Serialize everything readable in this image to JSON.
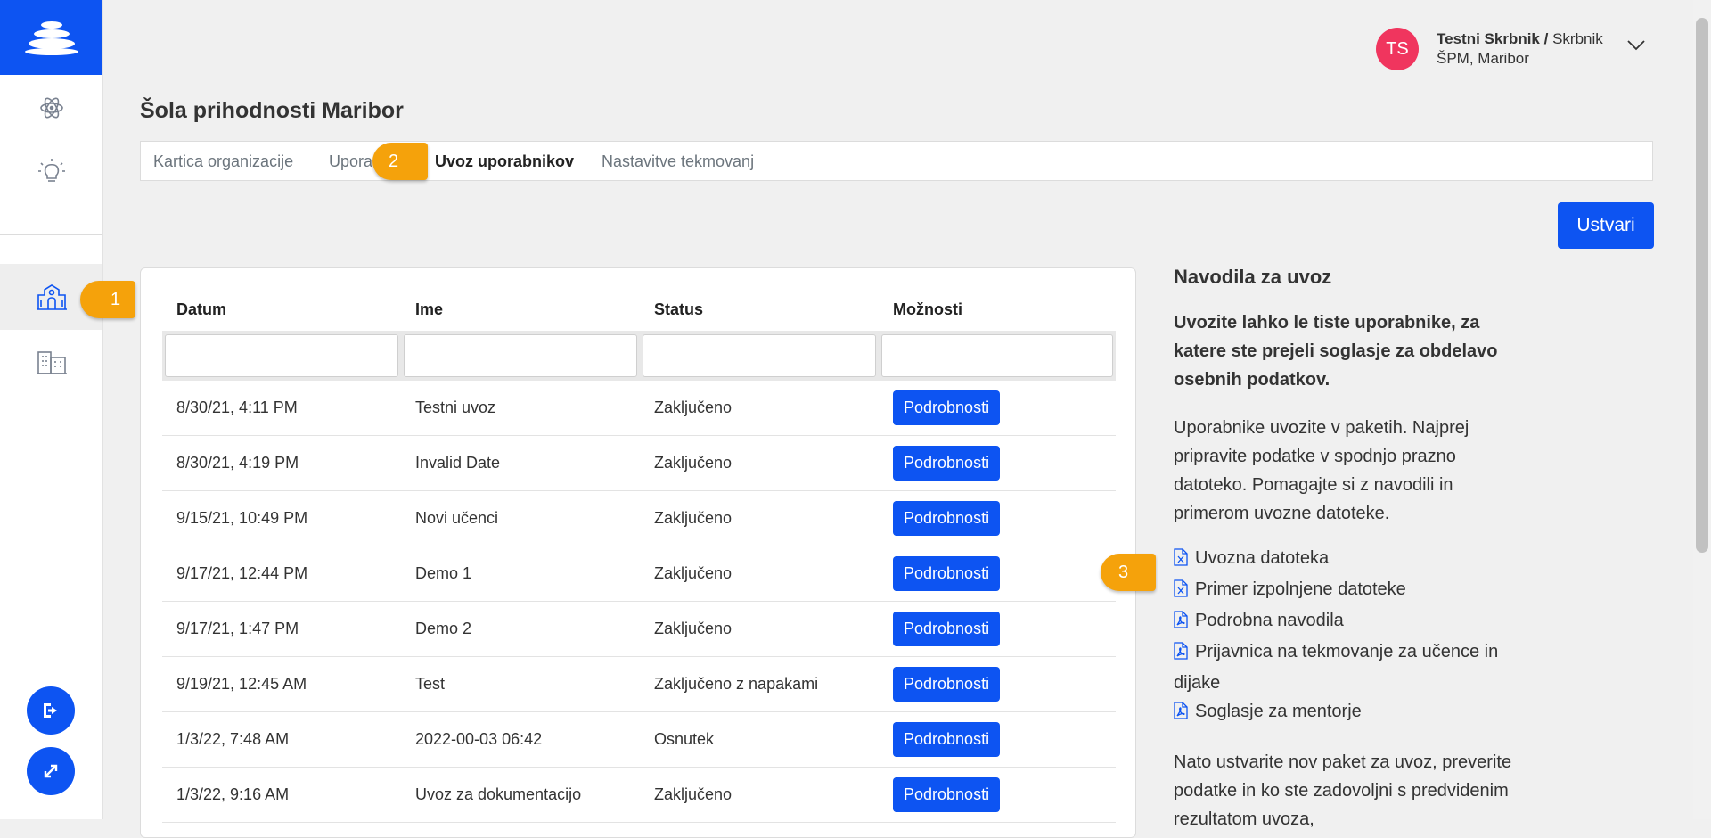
{
  "user": {
    "initials": "TS",
    "name": "Testni Skrbnik /",
    "role": "Skrbnik",
    "org": "ŠPM, Maribor"
  },
  "page": {
    "title": "Šola prihodnosti Maribor"
  },
  "tabs": [
    {
      "label": "Kartica organizacije"
    },
    {
      "label": "Upora"
    },
    {
      "label": "Uvoz uporabnikov"
    },
    {
      "label": "Nastavitve tekmovanj"
    }
  ],
  "actions": {
    "create": "Ustvari"
  },
  "table": {
    "headers": [
      "Datum",
      "Ime",
      "Status",
      "Možnosti"
    ],
    "button_label": "Podrobnosti",
    "rows": [
      {
        "date": "8/30/21, 4:11 PM",
        "name": "Testni uvoz",
        "status": "Zaključeno"
      },
      {
        "date": "8/30/21, 4:19 PM",
        "name": "Invalid Date",
        "status": "Zaključeno"
      },
      {
        "date": "9/15/21, 10:49 PM",
        "name": "Novi učenci",
        "status": "Zaključeno"
      },
      {
        "date": "9/17/21, 12:44 PM",
        "name": "Demo 1",
        "status": "Zaključeno"
      },
      {
        "date": "9/17/21, 1:47 PM",
        "name": "Demo 2",
        "status": "Zaključeno"
      },
      {
        "date": "9/19/21, 12:45 AM",
        "name": "Test",
        "status": "Zaključeno z napakami"
      },
      {
        "date": "1/3/22, 7:48 AM",
        "name": "2022-00-03 06:42",
        "status": "Osnutek"
      },
      {
        "date": "1/3/22, 9:16 AM",
        "name": "Uvoz za dokumentacijo",
        "status": "Zaključeno"
      }
    ]
  },
  "instructions": {
    "title": "Navodila za uvoz",
    "lead": "Uvozite lahko le tiste uporabnike, za katere ste prejeli soglasje za obdelavo osebnih podatkov.",
    "para1": "Uporabnike uvozite v paketih. Najprej pripravite podatke v spodnjo prazno datoteko. Pomagajte si z navodili in primerom uvozne datoteke.",
    "links": [
      {
        "label": "Uvozna datoteka",
        "icon": "excel-file-icon"
      },
      {
        "label": "Primer izpolnjene datoteke",
        "icon": "excel-file-icon"
      },
      {
        "label": "Podrobna navodila",
        "icon": "pdf-file-icon"
      },
      {
        "label": "Prijavnica na tekmovanje za učence in dijake",
        "icon": "pdf-file-icon"
      },
      {
        "label": "Soglasje za mentorje",
        "icon": "pdf-file-icon"
      }
    ],
    "para2": "Nato ustvarite nov paket za uvoz, preverite podatke in ko ste zadovoljni s predvidenim rezultatom uvoza,"
  },
  "callouts": [
    "1",
    "2",
    "3"
  ],
  "colors": {
    "primary": "#0d54f2",
    "callout": "#f5a20b",
    "avatar": "#f0355e"
  }
}
